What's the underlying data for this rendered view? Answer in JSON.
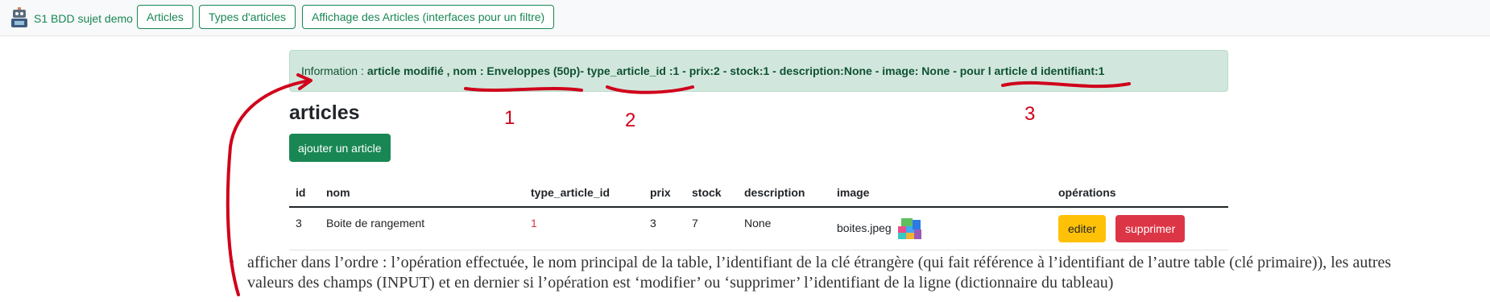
{
  "navbar": {
    "brand": "S1 BDD sujet demo",
    "links": [
      "Articles",
      "Types d'articles",
      "Affichage des Articles (interfaces pour un filtre)"
    ]
  },
  "flash": {
    "prefix": "Information :",
    "message": "article modifié , nom : Enveloppes (50p)- type_article_id :1 - prix:2 - stock:1 - description:None - image: None - pour l article d identifiant:1"
  },
  "page": {
    "title": "articles",
    "add_button": "ajouter un article"
  },
  "table": {
    "headers": {
      "id": "id",
      "nom": "nom",
      "type": "type_article_id",
      "prix": "prix",
      "stock": "stock",
      "description": "description",
      "image": "image",
      "operations": "opérations"
    },
    "rows": [
      {
        "id": "3",
        "nom": "Boite de rangement",
        "type_article_id": "1",
        "prix": "3",
        "stock": "7",
        "description": "None",
        "image": "boites.jpeg",
        "edit": "editer",
        "delete": "supprimer"
      }
    ]
  },
  "note": {
    "bullet": "•",
    "text": "afficher dans l’ordre : l’opération effectuée, le nom principal de la table, l’identifiant de la clé étrangère (qui fait référence à l’identifiant de l’autre table (clé primaire)), les autres valeurs des champs (INPUT) et en dernier si l’opération est ‘modifier’ ou ‘supprimer’ l’identifiant de la ligne (dictionnaire du tableau)"
  },
  "annotations": {
    "mark1": "1",
    "mark2": "2",
    "mark3": "3",
    "color": "#d0021b"
  },
  "colors": {
    "success": "#198754",
    "alert_bg": "#d1e7dd",
    "warning": "#ffc107",
    "danger": "#dc3545"
  }
}
